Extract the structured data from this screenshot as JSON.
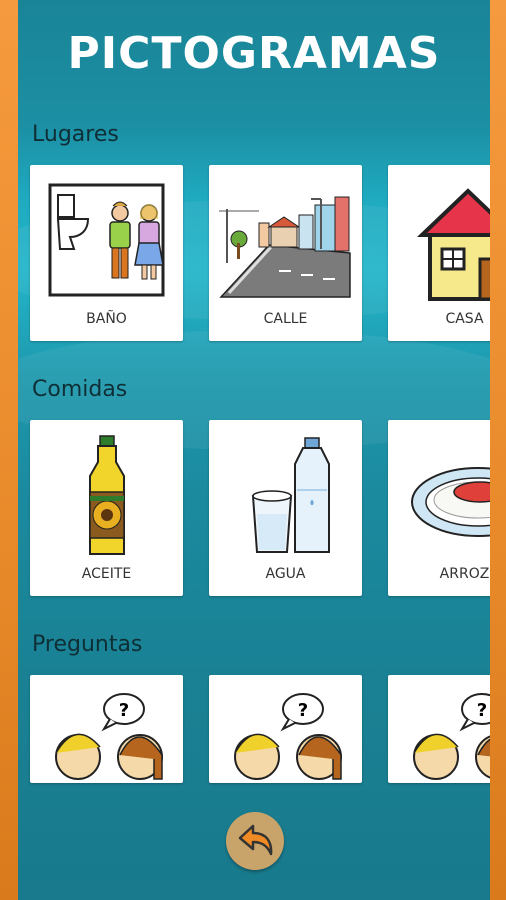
{
  "header": {
    "title": "PICTOGRAMAS"
  },
  "sections": [
    {
      "title": "Lugares",
      "items": [
        "BAÑO",
        "CALLE",
        "CASA"
      ]
    },
    {
      "title": "Comidas",
      "items": [
        "ACEITE",
        "AGUA",
        "ARROZ"
      ]
    },
    {
      "title": "Preguntas",
      "items": [
        "",
        "",
        ""
      ]
    }
  ],
  "colors": {
    "background": "#1a7f93",
    "frame": "#f59a3e",
    "title": "#ffffff",
    "back_button": "#c9a46a"
  },
  "icons": {
    "back": "back-arrow-icon"
  }
}
